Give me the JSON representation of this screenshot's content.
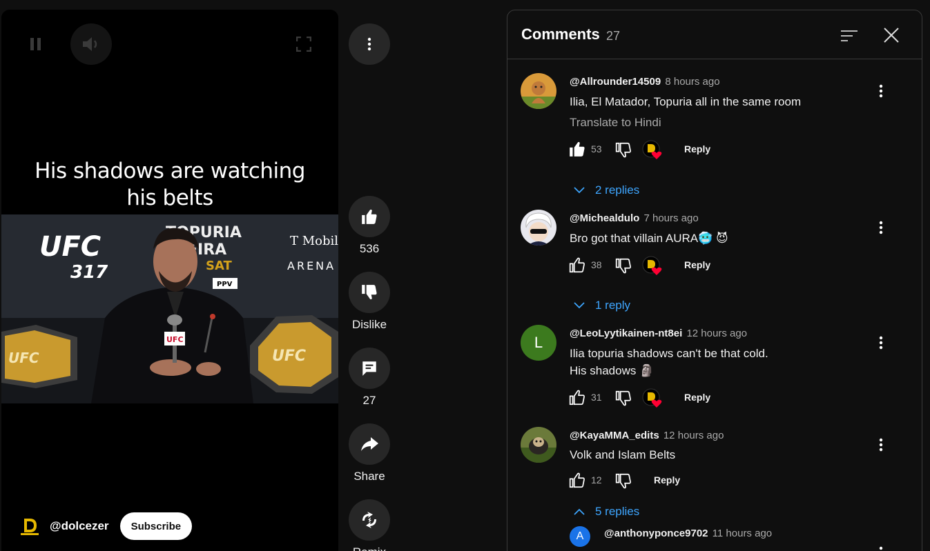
{
  "player": {
    "caption_line1": "His shadows are watching",
    "caption_line2": "his belts",
    "frame": {
      "ufc_number": "317",
      "ufc_brand": "UFC",
      "backdrop_line1": "TOPURIA",
      "backdrop_line2": "VEIRA",
      "backdrop_sat": "SAT",
      "backdrop_ppv": "PPV",
      "sponsor": "T Mobile",
      "sponsor_sub": "ARENA",
      "mic_logo": "UFC",
      "belt_text": "UFC"
    },
    "channel_name": "@dolcezer",
    "subscribe_label": "Subscribe"
  },
  "actions": {
    "like_count": "536",
    "dislike_label": "Dislike",
    "comments_count": "27",
    "share_label": "Share",
    "remix_label": "Remix"
  },
  "comments_panel": {
    "title": "Comments",
    "count": "27",
    "items": [
      {
        "author": "@Allrounder14509",
        "time": "8 hours ago",
        "text": "Ilia, El Matador, Topuria all in the same room",
        "translate": "Translate to Hindi",
        "likes": "53",
        "reply_label": "Reply",
        "replies": "2 replies"
      },
      {
        "author": "@Michealdulo",
        "time": "7 hours ago",
        "text": "Bro got that villain AURA🥶 😈",
        "likes": "38",
        "reply_label": "Reply",
        "replies": "1 reply"
      },
      {
        "author": "@LeoLyytikainen-nt8ei",
        "time": "12 hours ago",
        "text_line1": "Ilia topuria shadows can't be that cold.",
        "text_line2": "His shadows 🗿",
        "avatar_letter": "L",
        "likes": "31",
        "reply_label": "Reply"
      },
      {
        "author": "@KayaMMA_edits",
        "time": "12 hours ago",
        "text": "Volk and Islam Belts",
        "likes": "12",
        "reply_label": "Reply",
        "replies": "5 replies"
      }
    ],
    "first_reply": {
      "avatar_letter": "A",
      "author": "@anthonyponce9702",
      "time": "11 hours ago"
    }
  },
  "colors": {
    "background": "#0f0f0f",
    "button_bg": "#272727",
    "link_blue": "#3ea6ff",
    "heart_red": "#ff0033",
    "muted_text": "#aaaaaa"
  }
}
